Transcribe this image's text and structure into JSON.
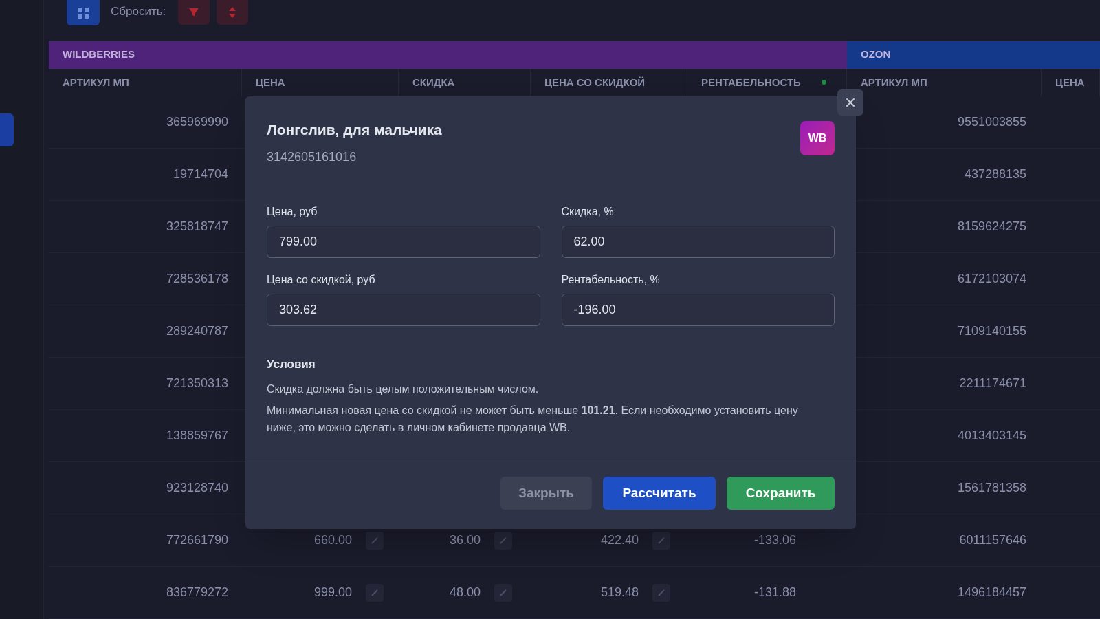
{
  "toolbar": {
    "reset_label": "Сбросить:"
  },
  "table": {
    "groups": [
      {
        "label": "WILDBERRIES",
        "kind": "wildberries"
      },
      {
        "label": "OZON",
        "kind": "ozon"
      }
    ],
    "columns": [
      "АРТИКУЛ МП",
      "ЦЕНА",
      "СКИДКА",
      "ЦЕНА СО СКИДКОЙ",
      "РЕНТАБЕЛЬНОСТЬ",
      "АРТИКУЛ МП",
      "ЦЕНА"
    ],
    "rows": [
      {
        "wb_article": "365969990",
        "ozon_article": "9551003855"
      },
      {
        "wb_article": "19714704",
        "ozon_article": "437288135"
      },
      {
        "wb_article": "325818747",
        "ozon_article": "8159624275"
      },
      {
        "wb_article": "728536178",
        "ozon_article": "6172103074"
      },
      {
        "wb_article": "289240787",
        "ozon_article": "7109140155"
      },
      {
        "wb_article": "721350313",
        "ozon_article": "2211174671"
      },
      {
        "wb_article": "138859767",
        "ozon_article": "4013403145"
      },
      {
        "wb_article": "923128740",
        "ozon_article": "1561781358"
      },
      {
        "wb_article": "772661790",
        "price": "660.00",
        "discount": "36.00",
        "discount_price": "422.40",
        "profitability": "-133.06",
        "ozon_article": "6011157646"
      },
      {
        "wb_article": "836779272",
        "price": "999.00",
        "discount": "48.00",
        "discount_price": "519.48",
        "profitability": "-131.88",
        "ozon_article": "1496184457"
      }
    ]
  },
  "dialog": {
    "title": "Лонгслив, для мальчика",
    "subtitle": "3142605161016",
    "badge": "WB",
    "fields": [
      {
        "label": "Цена, руб",
        "value": "799.00"
      },
      {
        "label": "Скидка, %",
        "value": "62.00"
      },
      {
        "label": "Цена со скидкой, руб",
        "value": "303.62"
      },
      {
        "label": "Рентабельность, %",
        "value": "-196.00"
      }
    ],
    "conditions": {
      "title": "Условия",
      "lines": [
        "Скидка должна быть целым положительным числом.",
        "Минимальная новая цена со скидкой не может быть меньше **101.21**. Если необходимо установить цену ниже, это можно сделать в личном кабинете продавца WB."
      ]
    },
    "buttons": [
      {
        "label": "Закрыть",
        "kind": "secondary"
      },
      {
        "label": "Рассчитать",
        "kind": "primary"
      },
      {
        "label": "Сохранить",
        "kind": "success"
      }
    ]
  }
}
